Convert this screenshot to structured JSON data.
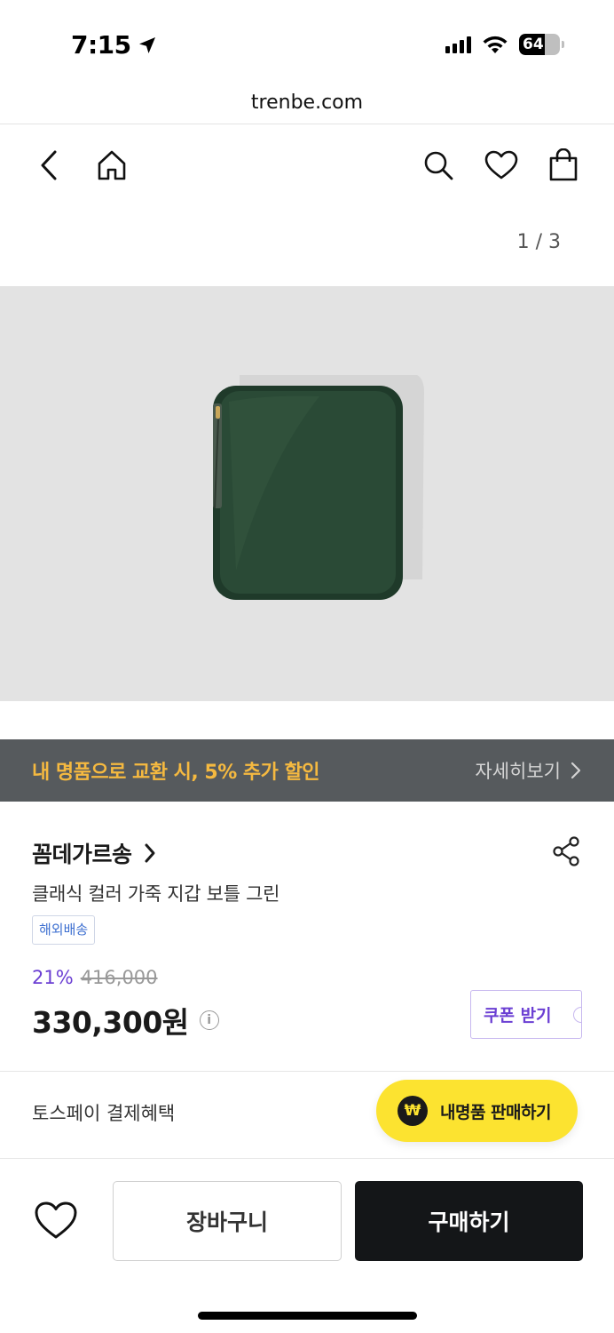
{
  "status_bar": {
    "time": "7:15",
    "battery": "64",
    "battery_level": 0.64
  },
  "browser": {
    "url": "trenbe.com"
  },
  "nav": {
    "back_icon": "chevron-left-icon",
    "home_icon": "home-icon",
    "search_icon": "search-icon",
    "wishlist_icon": "heart-icon",
    "bag_icon": "shopping-bag-icon"
  },
  "gallery": {
    "counter": "1 / 3"
  },
  "promo": {
    "text": "내 명품으로 교환 시, 5% 추가 할인",
    "link": "자세히보기"
  },
  "product": {
    "brand": "꼼데가르송",
    "name": "클래식 컬러 가죽 지갑 보틀 그린",
    "tag": "해외배송",
    "discount": "21%",
    "original_price": "416,000",
    "price": "330,300원",
    "coupon": "쿠폰 받기"
  },
  "benefits": {
    "tosspay": "토스페이 결제혜택"
  },
  "floating": {
    "sell_label": "내명품 판매하기",
    "won_symbol": "₩"
  },
  "actions": {
    "cart": "장바구니",
    "buy": "구매하기"
  }
}
